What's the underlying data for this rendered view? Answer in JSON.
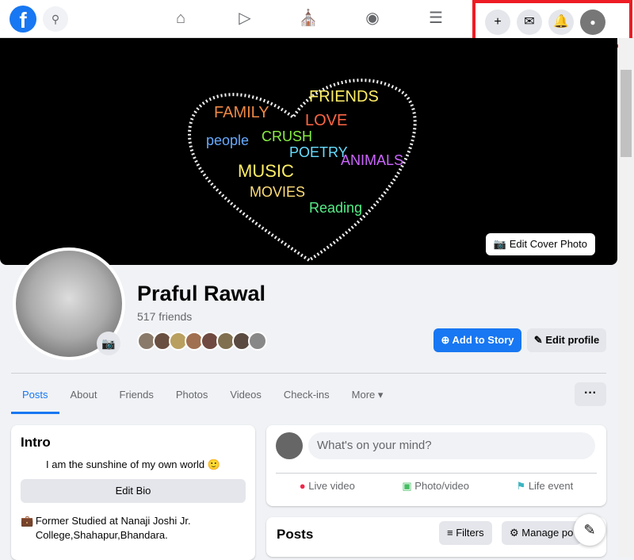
{
  "topbar": {
    "logo": "f",
    "search_icon": "search-icon",
    "nav": [
      "home-icon",
      "watch-icon",
      "marketplace-icon",
      "groups-icon",
      "menu-icon"
    ],
    "right": [
      "plus-icon",
      "messenger-icon",
      "bell-icon",
      "profile-avatar"
    ]
  },
  "cover": {
    "words": [
      "FAMILY",
      "FRIENDS",
      "LOVE",
      "people",
      "CRUSH",
      "POETRY",
      "ANIMALS",
      "MUSIC",
      "MOVIES",
      "Reading"
    ],
    "edit_label": "Edit Cover Photo"
  },
  "profile": {
    "name": "Praful Rawal",
    "friends": "517 friends",
    "add_story": "Add to Story",
    "edit_profile": "Edit profile"
  },
  "tabs": [
    "Posts",
    "About",
    "Friends",
    "Photos",
    "Videos",
    "Check-ins",
    "More ▾"
  ],
  "more_label": "···",
  "intro": {
    "title": "Intro",
    "bio": "I am the sunshine of my own world 🙂",
    "edit_bio": "Edit Bio",
    "edu_prefix": "Former Studied at ",
    "edu_school": "Nanaji Joshi Jr. College,Shahapur,Bhandara."
  },
  "composer": {
    "placeholder": "What's on your mind?",
    "live": "Live video",
    "photo": "Photo/video",
    "life": "Life event"
  },
  "posts": {
    "title": "Posts",
    "filters": "Filters",
    "manage": "Manage po"
  },
  "colors": {
    "accent": "#1877f2",
    "highlight": "#ee1c24"
  }
}
